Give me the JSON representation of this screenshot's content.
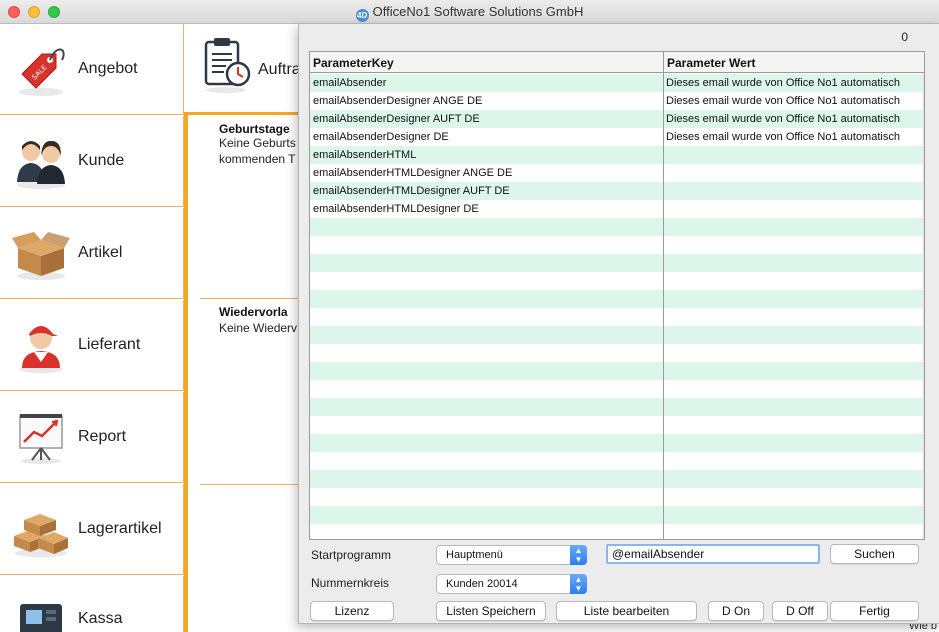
{
  "window": {
    "title": "OfficeNo1 Software Solutions GmbH",
    "app_icon": "4D"
  },
  "sidebar": {
    "items": [
      {
        "label": "Angebot",
        "icon": "price-tag-icon"
      },
      {
        "label": "Kunde",
        "icon": "customers-icon"
      },
      {
        "label": "Artikel",
        "icon": "box-icon"
      },
      {
        "label": "Lieferant",
        "icon": "delivery-person-icon"
      },
      {
        "label": "Report",
        "icon": "chart-board-icon"
      },
      {
        "label": "Lagerartikel",
        "icon": "stacked-boxes-icon"
      },
      {
        "label": "Kassa",
        "icon": "cash-register-icon"
      }
    ]
  },
  "main": {
    "top_item": {
      "label": "Auftra",
      "icon": "clipboard-clock-icon"
    },
    "birthdays": {
      "title": "Geburtstage",
      "line1": "Keine Geburts",
      "line2": "kommenden T"
    },
    "reminders": {
      "title": "Wiedervorla",
      "line1": "Keine Wiederv"
    },
    "corner_text": "Wie b"
  },
  "dialog": {
    "counter": "0",
    "table": {
      "headers": [
        "ParameterKey",
        "Parameter Wert"
      ],
      "rows": [
        {
          "key": "emailAbsender",
          "value": "Dieses email wurde von Office No1 automatisch"
        },
        {
          "key": "emailAbsenderDesigner ANGE DE",
          "value": "Dieses email wurde von Office No1 automatisch"
        },
        {
          "key": "emailAbsenderDesigner AUFT DE",
          "value": "Dieses email wurde von Office No1 automatisch"
        },
        {
          "key": "emailAbsenderDesigner DE",
          "value": "Dieses email wurde von Office No1 automatisch"
        },
        {
          "key": "emailAbsenderHTML",
          "value": ""
        },
        {
          "key": "emailAbsenderHTMLDesigner ANGE DE",
          "value": ""
        },
        {
          "key": "emailAbsenderHTMLDesigner AUFT DE",
          "value": ""
        },
        {
          "key": "emailAbsenderHTMLDesigner DE",
          "value": ""
        },
        {
          "key": "",
          "value": ""
        },
        {
          "key": "",
          "value": ""
        },
        {
          "key": "",
          "value": ""
        },
        {
          "key": "",
          "value": ""
        },
        {
          "key": "",
          "value": ""
        },
        {
          "key": "",
          "value": ""
        },
        {
          "key": "",
          "value": ""
        },
        {
          "key": "",
          "value": ""
        },
        {
          "key": "",
          "value": ""
        },
        {
          "key": "",
          "value": ""
        },
        {
          "key": "",
          "value": ""
        },
        {
          "key": "",
          "value": ""
        },
        {
          "key": "",
          "value": ""
        },
        {
          "key": "",
          "value": ""
        },
        {
          "key": "",
          "value": ""
        },
        {
          "key": "",
          "value": ""
        },
        {
          "key": "",
          "value": ""
        },
        {
          "key": "",
          "value": ""
        }
      ]
    },
    "startprogramm": {
      "label": "Startprogramm",
      "value": "Hauptmenü"
    },
    "nummernkreis": {
      "label": "Nummernkreis",
      "value": "Kunden 20014"
    },
    "search": {
      "value": "@emailAbsender",
      "button": "Suchen"
    },
    "buttons": {
      "lizenz": "Lizenz",
      "listen_speichern": "Listen Speichern",
      "liste_bearbeiten": "Liste bearbeiten",
      "d_on": "D On",
      "d_off": "D Off",
      "fertig": "Fertig"
    }
  },
  "colors": {
    "accent": "#f5a623",
    "row_alt": "#dcf6ea",
    "select_arrow": "#2f7ef0"
  }
}
